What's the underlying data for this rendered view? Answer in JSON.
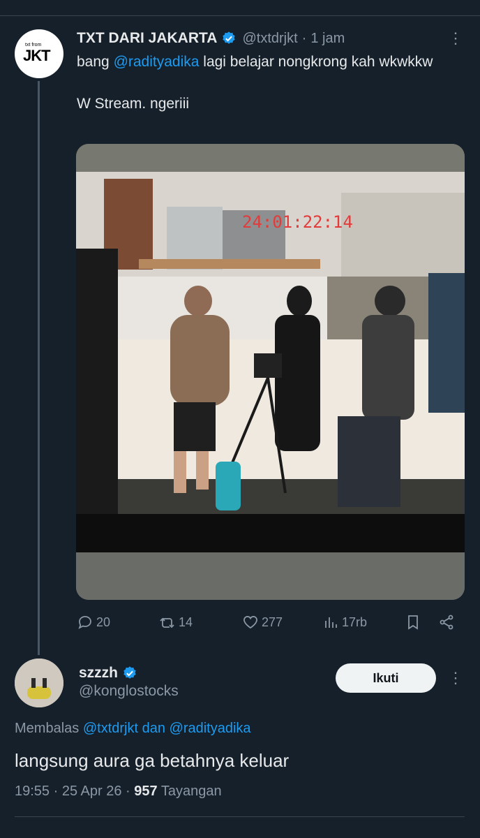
{
  "tweet": {
    "author_name": "TXT DARI JAKARTA",
    "author_handle": "@txtdrjkt",
    "separator": "·",
    "time": "1 jam",
    "avatar_small": "txt from",
    "avatar_big": "JKT",
    "text_prefix": "bang ",
    "mention": "@radityadika",
    "text_suffix": " lagi belajar nongkrong kah wkwkkw",
    "text_line2": "W Stream. ngeriii",
    "media_timestamp": "24:01:22:14",
    "actions": {
      "replies": "20",
      "retweets": "14",
      "likes": "277",
      "views": "17rb"
    }
  },
  "reply": {
    "author_name": "szzzh",
    "author_handle": "@konglostocks",
    "follow_label": "Ikuti",
    "replying_label": "Membalas",
    "replying_to_1": "@txtdrjkt",
    "replying_and": "dan",
    "replying_to_2": "@radityadika",
    "text": "langsung aura ga betahnya keluar",
    "time": "19:55",
    "date": "25 Apr 26",
    "views_count": "957",
    "views_label": "Tayangan"
  },
  "colors": {
    "background": "#15202b",
    "accent": "#1d9bf0",
    "secondary_text": "#8b98a5",
    "primary_text": "#e7e9ea"
  }
}
